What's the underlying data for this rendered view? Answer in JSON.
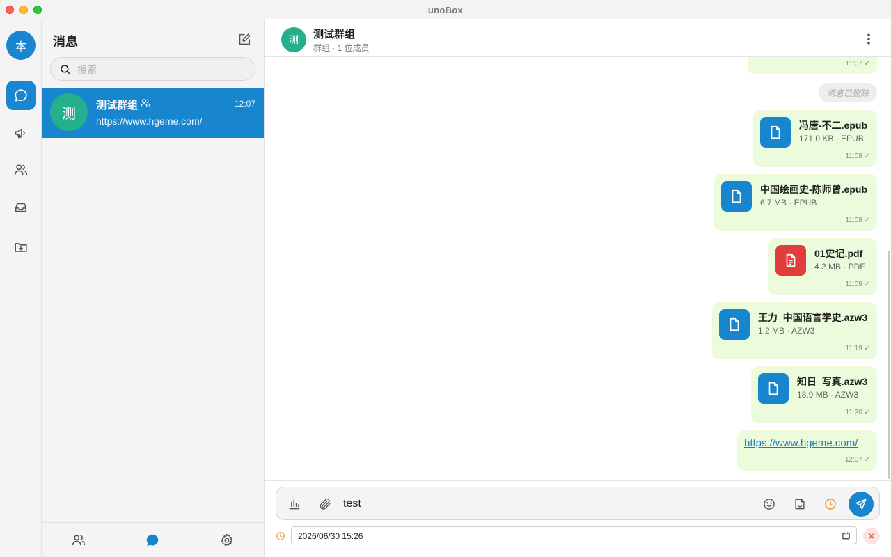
{
  "window": {
    "title": "unoBox"
  },
  "rail": {
    "avatar_text": "本",
    "icons": [
      "chat-icon",
      "megaphone-icon",
      "contacts-icon",
      "inbox-icon",
      "folder-add-icon"
    ]
  },
  "list": {
    "title": "消息",
    "search_placeholder": "搜索",
    "conversations": [
      {
        "avatar": "测",
        "name": "测试群组",
        "time": "12:07",
        "preview": "https://www.hgeme.com/"
      }
    ]
  },
  "chat": {
    "avatar": "测",
    "title": "测试群组",
    "subtitle": "群组 · 1 位成员",
    "top_time": "11:07 ✓",
    "deleted_text": "消息已删除",
    "files": [
      {
        "name": "冯唐-不二.epub",
        "meta": "171.0 KB · EPUB",
        "time": "11:08 ✓",
        "icon": "document-icon",
        "color": "#1786cf"
      },
      {
        "name": "中国绘画史-陈师曾.epub",
        "meta": "6.7 MB · EPUB",
        "time": "11:08 ✓",
        "icon": "document-icon",
        "color": "#1786cf"
      },
      {
        "name": "01史记.pdf",
        "meta": "4.2 MB · PDF",
        "time": "11:09 ✓",
        "icon": "pdf-document-icon",
        "color": "#e23d3d"
      },
      {
        "name": "王力_中国语言学史.azw3",
        "meta": "1.2 MB · AZW3",
        "time": "11:19 ✓",
        "icon": "document-icon",
        "color": "#1786cf"
      },
      {
        "name": "知日_写真.azw3",
        "meta": "18.9 MB · AZW3",
        "time": "11:20 ✓",
        "icon": "document-icon",
        "color": "#1786cf"
      }
    ],
    "link_message": {
      "text": "https://www.hgeme.com/",
      "time": "12:07 ✓"
    }
  },
  "composer": {
    "input_value": "test",
    "schedule_value": "2026/06/30 15:26",
    "cancel_glyph": "✕"
  },
  "colors": {
    "accent": "#1786cf",
    "bubble": "#ecfbdc",
    "group_avatar": "#23b08a",
    "pdf": "#e23d3d",
    "schedule": "#f29a2e"
  }
}
